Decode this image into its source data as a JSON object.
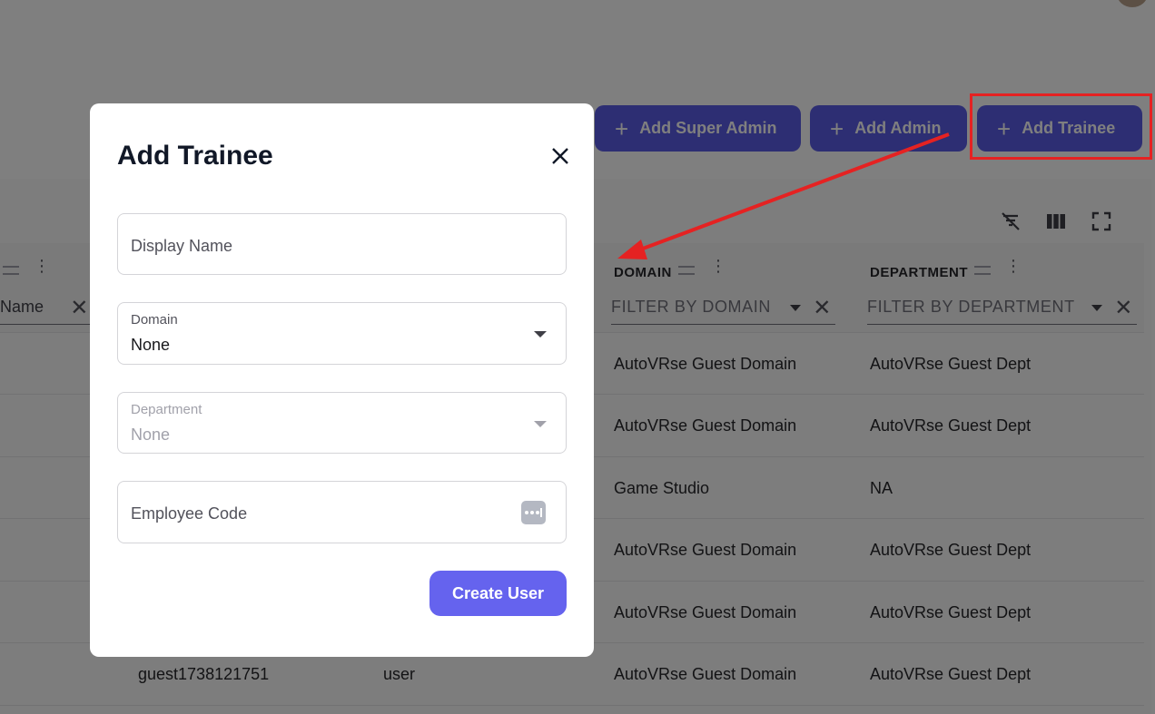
{
  "actions": {
    "add_super_admin": "Add Super Admin",
    "add_admin": "Add Admin",
    "add_trainee": "Add Trainee",
    "plus_glyph": "+"
  },
  "table": {
    "columns": [
      {
        "label": "",
        "filter_placeholder": "Name"
      },
      {
        "label": "DOMAIN",
        "filter_placeholder": "FILTER BY DOMAIN"
      },
      {
        "label": "DEPARTMENT",
        "filter_placeholder": "FILTER BY DEPARTMENT"
      }
    ],
    "rows": [
      {
        "name": "",
        "role": "",
        "domain": "AutoVRse Guest Domain",
        "department": "AutoVRse Guest Dept"
      },
      {
        "name": "",
        "role": "",
        "domain": "AutoVRse Guest Domain",
        "department": "AutoVRse Guest Dept"
      },
      {
        "name": "",
        "role": "",
        "domain": "Game Studio",
        "department": "NA"
      },
      {
        "name": "",
        "role": "",
        "domain": "AutoVRse Guest Domain",
        "department": "AutoVRse Guest Dept"
      },
      {
        "name": "",
        "role": "",
        "domain": "AutoVRse Guest Domain",
        "department": "AutoVRse Guest Dept"
      },
      {
        "name": "guest1738121751",
        "role": "user",
        "domain": "AutoVRse Guest Domain",
        "department": "AutoVRse Guest Dept"
      }
    ]
  },
  "modal": {
    "title": "Add Trainee",
    "close_glyph": "✕",
    "display_name_placeholder": "Display Name",
    "domain": {
      "label": "Domain",
      "value": "None"
    },
    "department": {
      "label": "Department",
      "value": "None"
    },
    "employee_code_placeholder": "Employee Code",
    "submit_label": "Create User"
  },
  "colors": {
    "primary": "#5b5ce6",
    "create_button": "#6563ee",
    "annotation_red": "#e52222"
  }
}
